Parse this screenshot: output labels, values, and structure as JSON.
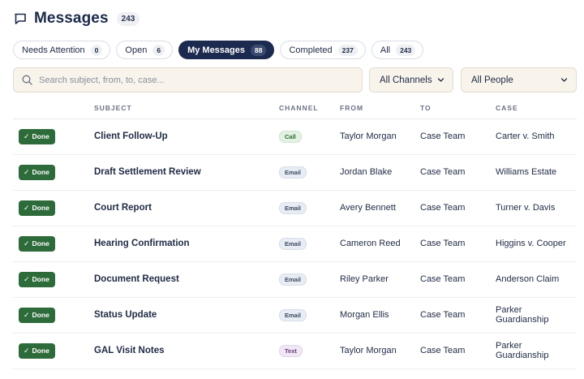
{
  "header": {
    "title": "Messages",
    "count": "243"
  },
  "tabs": [
    {
      "label": "Needs Attention",
      "count": "0",
      "active": false
    },
    {
      "label": "Open",
      "count": "6",
      "active": false
    },
    {
      "label": "My Messages",
      "count": "88",
      "active": true
    },
    {
      "label": "Completed",
      "count": "237",
      "active": false
    },
    {
      "label": "All",
      "count": "243",
      "active": false
    }
  ],
  "search": {
    "placeholder": "Search subject, from, to, case..."
  },
  "filters": {
    "channels": "All Channels",
    "people": "All People"
  },
  "columns": {
    "status": "",
    "subject": "SUBJECT",
    "channel": "CHANNEL",
    "from": "FROM",
    "to": "TO",
    "case": "CASE"
  },
  "rows": [
    {
      "status": "Done",
      "subject": "Client Follow-Up",
      "channel": "Call",
      "from": "Taylor Morgan",
      "to": "Case Team",
      "case": "Carter v. Smith"
    },
    {
      "status": "Done",
      "subject": "Draft Settlement Review",
      "channel": "Email",
      "from": "Jordan Blake",
      "to": "Case Team",
      "case": "Williams Estate"
    },
    {
      "status": "Done",
      "subject": "Court Report",
      "channel": "Email",
      "from": "Avery Bennett",
      "to": "Case Team",
      "case": "Turner v. Davis"
    },
    {
      "status": "Done",
      "subject": "Hearing Confirmation",
      "channel": "Email",
      "from": "Cameron Reed",
      "to": "Case Team",
      "case": "Higgins v. Cooper"
    },
    {
      "status": "Done",
      "subject": "Document Request",
      "channel": "Email",
      "from": "Riley Parker",
      "to": "Case Team",
      "case": "Anderson Claim"
    },
    {
      "status": "Done",
      "subject": "Status Update",
      "channel": "Email",
      "from": "Morgan Ellis",
      "to": "Case Team",
      "case": "Parker Guardianship"
    },
    {
      "status": "Done",
      "subject": "GAL Visit Notes",
      "channel": "Text",
      "from": "Taylor Morgan",
      "to": "Case Team",
      "case": "Parker Guardianship"
    }
  ],
  "colors": {
    "navy": "#1b2a4e",
    "done_green": "#2e6b3a",
    "search_bg": "#f8f4ec"
  },
  "icons": {
    "header": "chat-bubble-icon",
    "search": "search-icon",
    "select": "chevron-down-icon",
    "status": "check-icon"
  }
}
